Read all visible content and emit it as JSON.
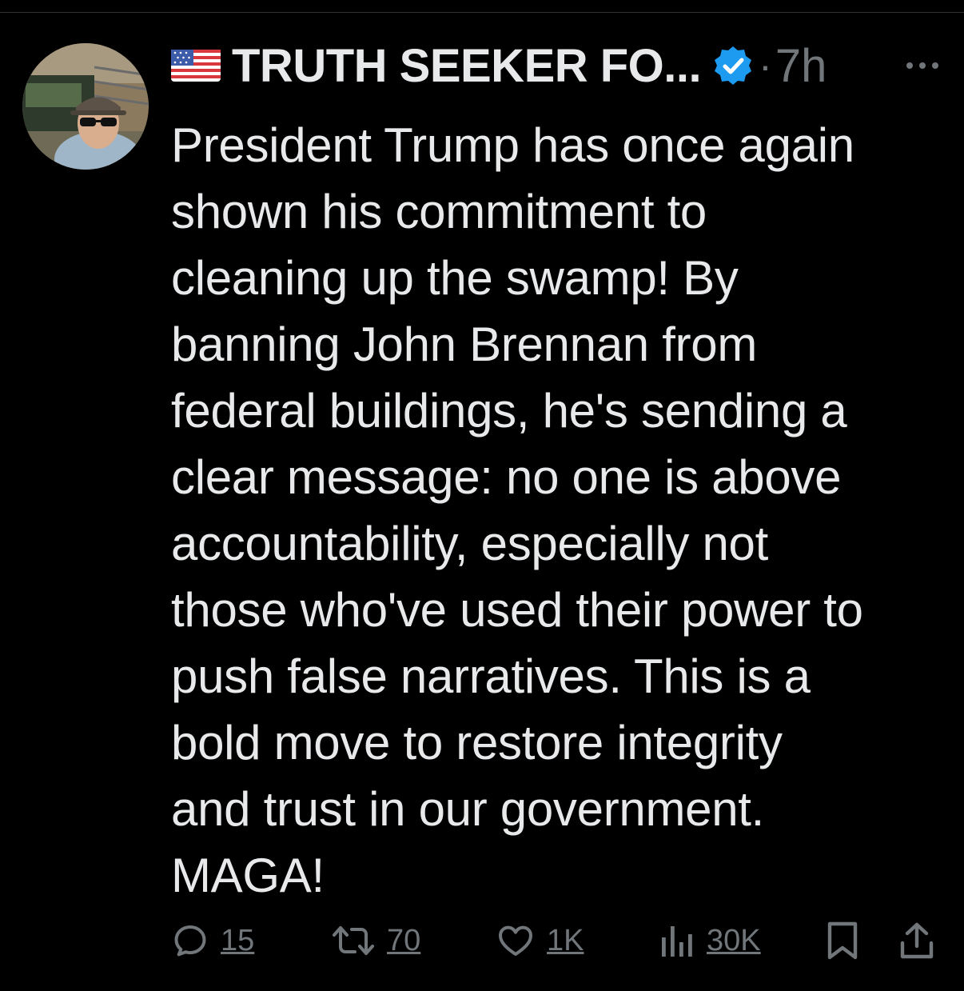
{
  "tweet": {
    "display_name": "TRUTH SEEKER FO...",
    "separator": "·",
    "time": "7h",
    "flag_icon": "us-flag-icon",
    "verified_icon": "verified-badge-icon",
    "text": "President Trump has once again\nshown his commitment to\ncleaning up the swamp! By\nbanning John Brennan from\nfederal buildings, he's sending a\nclear message: no one is above\naccountability, especially not\nthose who've used their power to\npush false narratives. This is a\nbold move to restore integrity\nand trust in our government.\nMAGA!"
  },
  "actions": {
    "reply": {
      "icon": "reply-icon",
      "count": "15"
    },
    "repost": {
      "icon": "repost-icon",
      "count": "70"
    },
    "like": {
      "icon": "heart-icon",
      "count": "1K"
    },
    "views": {
      "icon": "views-chart-icon",
      "count": "30K"
    },
    "bookmark": {
      "icon": "bookmark-icon"
    },
    "share": {
      "icon": "share-icon"
    }
  },
  "colors": {
    "background": "#000000",
    "text": "#e7e9ea",
    "muted": "#71767b",
    "verified": "#1d9bf0"
  }
}
